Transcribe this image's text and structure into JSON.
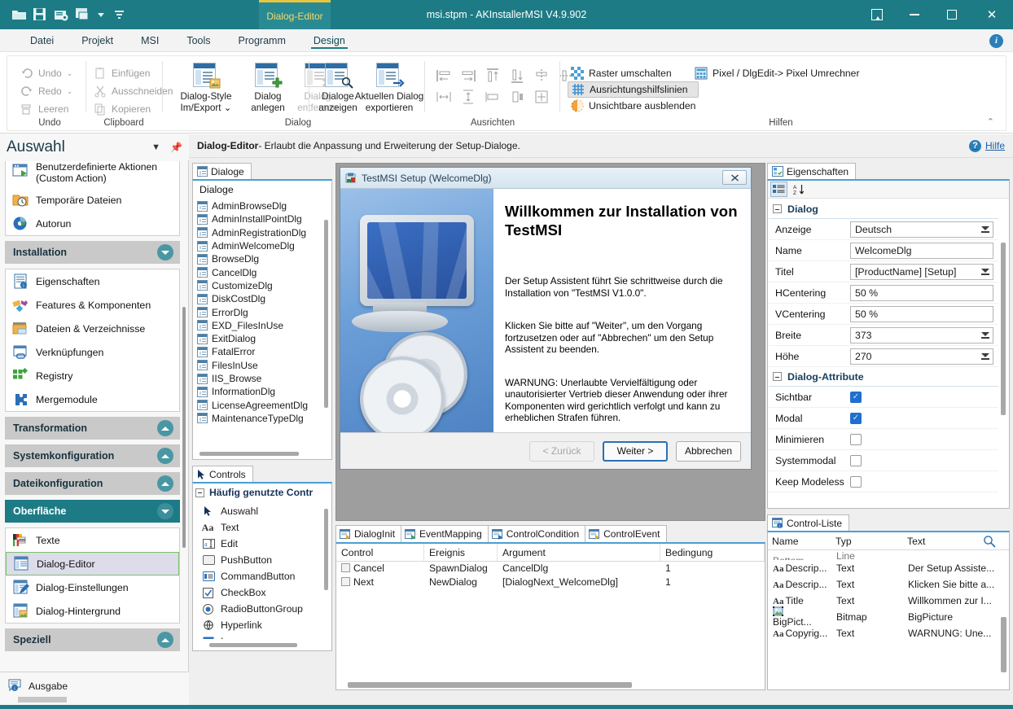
{
  "window": {
    "title": "msi.stpm - AKInstallerMSI V4.9.902",
    "ribbon_tab_title": "Dialog-Editor",
    "quick_access": [
      "open-icon",
      "save-icon",
      "save-as-icon",
      "windows-icon",
      "chevron-down-icon",
      "more-icon"
    ],
    "buttons": {
      "restore": "restore-icon",
      "minimize": "minimize-icon",
      "maximize": "maximize-icon",
      "close": "close-icon"
    }
  },
  "menubar": {
    "items": [
      "Datei",
      "Projekt",
      "MSI",
      "Tools",
      "Programm",
      "Design"
    ],
    "active": "Design",
    "info_badge": "i"
  },
  "ribbon": {
    "groups": [
      {
        "label": "Undo",
        "small_buttons": [
          "Undo",
          "Redo",
          "Leeren"
        ]
      },
      {
        "label": "Clipboard",
        "small_buttons": [
          "Einfügen",
          "Ausschneiden",
          "Kopieren"
        ]
      },
      {
        "label": "Dialog",
        "big_buttons": [
          {
            "label": "Dialog-Style\nIm/Export ⌄",
            "disabled": false
          },
          {
            "label": "Dialog\nanlegen",
            "disabled": false
          },
          {
            "label": "Dialog\nentfernen",
            "disabled": true
          },
          {
            "label": "Aktuellen Dialog\nexportieren",
            "disabled": false
          },
          {
            "label": "Dialoge\nanzeigen",
            "disabled": false
          }
        ]
      },
      {
        "label": "Ausrichten"
      },
      {
        "label": "Hilfen",
        "help_items": [
          {
            "label": "Raster umschalten",
            "selected": false,
            "icon": "grid-toggle-icon"
          },
          {
            "label": "Ausrichtungshilfslinien",
            "selected": true,
            "icon": "guides-icon"
          },
          {
            "label": "Unsichtbare ausblenden",
            "selected": false,
            "icon": "hide-invisible-icon"
          }
        ],
        "help_items2": [
          {
            "label": "Pixel / DlgEdit-> Pixel Umrechner",
            "icon": "calculator-icon"
          }
        ]
      }
    ]
  },
  "context_header": {
    "title": "Dialog-Editor",
    "subtitle": " - Erlaubt die Anpassung und Erweiterung der Setup-Dialoge.",
    "help_label": "Hilfe"
  },
  "sidebar": {
    "title": "Auswahl",
    "top_items": [
      {
        "label": "Benutzerdefinierte Aktionen (Custom Action)",
        "icon": "custom-action-icon"
      },
      {
        "label": "Temporäre Dateien",
        "icon": "temp-files-icon"
      },
      {
        "label": "Autorun",
        "icon": "autorun-icon"
      }
    ],
    "groups": [
      {
        "label": "Installation",
        "expanded": true,
        "active": false,
        "items": [
          {
            "label": "Eigenschaften",
            "icon": "properties-icon"
          },
          {
            "label": "Features & Komponenten",
            "icon": "features-icon"
          },
          {
            "label": "Dateien & Verzeichnisse",
            "icon": "files-folders-icon"
          },
          {
            "label": "Verknüpfungen",
            "icon": "shortcuts-icon"
          },
          {
            "label": "Registry",
            "icon": "registry-icon"
          },
          {
            "label": "Mergemodule",
            "icon": "mergemodule-icon"
          }
        ]
      },
      {
        "label": "Transformation",
        "expanded": false,
        "active": false,
        "items": []
      },
      {
        "label": "Systemkonfiguration",
        "expanded": false,
        "active": false,
        "items": []
      },
      {
        "label": "Dateikonfiguration",
        "expanded": false,
        "active": false,
        "items": []
      },
      {
        "label": "Oberfläche",
        "expanded": true,
        "active": true,
        "items": [
          {
            "label": "Texte",
            "icon": "flags-texts-icon",
            "selected": false
          },
          {
            "label": "Dialog-Editor",
            "icon": "dialog-editor-icon",
            "selected": true
          },
          {
            "label": "Dialog-Einstellungen",
            "icon": "dialog-settings-icon",
            "selected": false
          },
          {
            "label": "Dialog-Hintergrund",
            "icon": "dialog-background-icon",
            "selected": false
          }
        ]
      },
      {
        "label": "Speziell",
        "expanded": false,
        "active": false,
        "items": []
      }
    ],
    "output": {
      "label": "Ausgabe",
      "icon": "output-icon"
    }
  },
  "dialog_panel": {
    "tab": "Dialoge",
    "tab_icon": "dialog-icon",
    "header": "Dialoge",
    "items": [
      "AdminBrowseDlg",
      "AdminInstallPointDlg",
      "AdminRegistrationDlg",
      "AdminWelcomeDlg",
      "BrowseDlg",
      "CancelDlg",
      "CustomizeDlg",
      "DiskCostDlg",
      "ErrorDlg",
      "EXD_FilesInUse",
      "ExitDialog",
      "FatalError",
      "FilesInUse",
      "IIS_Browse",
      "InformationDlg",
      "LicenseAgreementDlg",
      "MaintenanceTypeDlg"
    ]
  },
  "controls_panel": {
    "tab": "Controls",
    "tab_icon": "arrow-pointer-icon",
    "group_label": "Häufig genutzte Contr",
    "items": [
      {
        "label": "Auswahl",
        "icon": "arrow-pointer-icon"
      },
      {
        "label": "Text",
        "icon": "text-icon"
      },
      {
        "label": "Edit",
        "icon": "edit-icon"
      },
      {
        "label": "PushButton",
        "icon": "pushbutton-icon"
      },
      {
        "label": "CommandButton",
        "icon": "commandbutton-icon"
      },
      {
        "label": "CheckBox",
        "icon": "checkbox-icon"
      },
      {
        "label": "RadioButtonGroup",
        "icon": "radiobutton-icon"
      },
      {
        "label": "Hyperlink",
        "icon": "hyperlink-icon"
      },
      {
        "label": "Icon",
        "icon": "icon-icon"
      }
    ]
  },
  "preview": {
    "title": "TestMSI Setup  (WelcomeDlg)",
    "title_icon": "msi-package-icon",
    "close_label": "✖",
    "heading": "Willkommen zur Installation von TestMSI",
    "paragraph1": "Der Setup Assistent führt Sie schrittweise durch die Installation von \"TestMSI  V1.0.0\".",
    "paragraph2": "Klicken Sie bitte auf \"Weiter\", um den Vorgang fortzusetzen oder auf \"Abbrechen\" um den Setup Assistent zu beenden.",
    "paragraph3": "WARNUNG: Unerlaubte Vervielfältigung oder unautorisierter Vertrieb dieser Anwendung oder ihrer Komponenten wird gerichtlich verfolgt und kann zu erheblichen Strafen führen.",
    "buttons": {
      "back": "< Zurück",
      "next": "Weiter >",
      "cancel": "Abbrechen"
    }
  },
  "event_panel": {
    "tabs": [
      {
        "label": "DialogInit",
        "icon": "dialog-init-icon",
        "active": false
      },
      {
        "label": "EventMapping",
        "icon": "event-mapping-icon",
        "active": false
      },
      {
        "label": "ControlCondition",
        "icon": "control-condition-icon",
        "active": false
      },
      {
        "label": "ControlEvent",
        "icon": "control-event-icon",
        "active": true
      }
    ],
    "columns": [
      "Control",
      "Ereignis",
      "Argument",
      "Bedingung"
    ],
    "rows": [
      {
        "control": "Cancel",
        "ereignis": "SpawnDialog",
        "argument": "CancelDlg",
        "bedingung": "1"
      },
      {
        "control": "Next",
        "ereignis": "NewDialog",
        "argument": "[DialogNext_WelcomeDlg]",
        "bedingung": "1"
      }
    ]
  },
  "properties": {
    "tab": "Eigenschaften",
    "tab_icon": "properties-grid-icon",
    "toolbar": [
      {
        "icon": "categorized-icon",
        "selected": true
      },
      {
        "icon": "sort-az-icon",
        "selected": false
      }
    ],
    "categories": [
      {
        "label": "Dialog",
        "rows": [
          {
            "key": "Anzeige",
            "value": "Deutsch",
            "type": "dropdown"
          },
          {
            "key": "Name",
            "value": "WelcomeDlg",
            "type": "text"
          },
          {
            "key": "Titel",
            "value": "[ProductName] [Setup]",
            "type": "dropdown"
          },
          {
            "key": "HCentering",
            "value": "50 %",
            "type": "text"
          },
          {
            "key": "VCentering",
            "value": "50 %",
            "type": "text"
          },
          {
            "key": "Breite",
            "value": "373",
            "type": "dropdown"
          },
          {
            "key": "Höhe",
            "value": "270",
            "type": "dropdown"
          }
        ]
      },
      {
        "label": "Dialog-Attribute",
        "rows": [
          {
            "key": "Sichtbar",
            "value": "",
            "type": "checkbox",
            "checked": true
          },
          {
            "key": "Modal",
            "value": "",
            "type": "checkbox",
            "checked": true
          },
          {
            "key": "Minimieren",
            "value": "",
            "type": "checkbox",
            "checked": false
          },
          {
            "key": "Systemmodal",
            "value": "",
            "type": "checkbox",
            "checked": false
          },
          {
            "key": "Keep Modeless",
            "value": "",
            "type": "checkbox",
            "checked": false
          }
        ]
      }
    ]
  },
  "control_list": {
    "tab": "Control-Liste",
    "tab_icon": "control-list-icon",
    "search_icon": "search-icon",
    "columns": [
      "Name",
      "Typ",
      "Text"
    ],
    "rows": [
      {
        "name": "Bottom...",
        "typ": "Line",
        "text": "",
        "icon": "line-icon",
        "clipped": true
      },
      {
        "name": "Descrip...",
        "typ": "Text",
        "text": "Der Setup Assiste...",
        "icon": "text-icon"
      },
      {
        "name": "Descrip...",
        "typ": "Text",
        "text": "Klicken Sie bitte a...",
        "icon": "text-icon"
      },
      {
        "name": "Title",
        "typ": "Text",
        "text": "Willkommen zur I...",
        "icon": "text-icon"
      },
      {
        "name": "BigPict...",
        "typ": "Bitmap",
        "text": "BigPicture",
        "icon": "bitmap-icon"
      },
      {
        "name": "Copyrig...",
        "typ": "Text",
        "text": "WARNUNG: Une...",
        "icon": "text-icon"
      }
    ]
  },
  "colors": {
    "accent": "#1d7b85",
    "tab_highlight": "#e8c53d",
    "selection": "#dcdcea",
    "link": "#1a5fa8"
  }
}
